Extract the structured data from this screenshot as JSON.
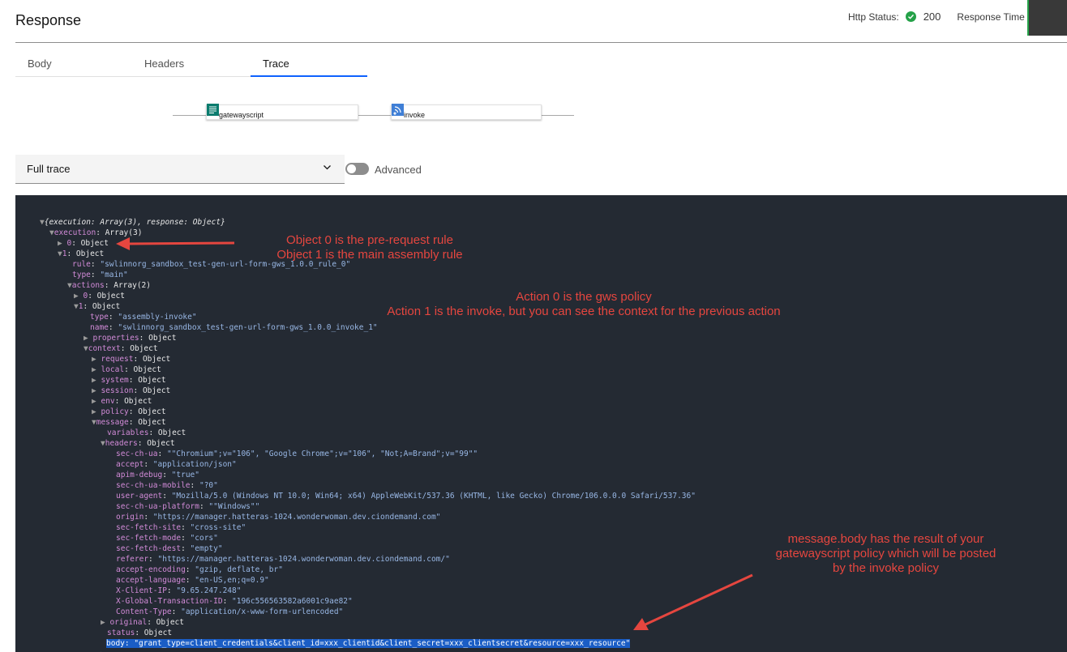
{
  "header": {
    "title": "Response",
    "http_status_label": "Http Status:",
    "http_status_code": "200",
    "response_time_label": "Response Time"
  },
  "tabs": [
    {
      "label": "Body"
    },
    {
      "label": "Headers"
    },
    {
      "label": "Trace"
    }
  ],
  "flow": {
    "node1": "gatewayscript",
    "node2": "invoke"
  },
  "controls": {
    "trace_select": "Full trace",
    "advanced_label": "Advanced"
  },
  "trace": {
    "l1": "{execution: Array(3), response: Object}",
    "l2k": "execution",
    "l2v": ": Array(3)",
    "l3k": "0",
    "l3v": ": Object",
    "l4k": "1",
    "l4v": ": Object",
    "l5k": "rule",
    "l5v": "\"swlinnorg_sandbox_test-gen-url-form-gws_1.0.0_rule_0\"",
    "l6k": "type",
    "l6v": "\"main\"",
    "l7k": "actions",
    "l7v": ": Array(2)",
    "l8k": "0",
    "l8v": ": Object",
    "l9k": "1",
    "l9v": ": Object",
    "l10k": "type",
    "l10v": "\"assembly-invoke\"",
    "l11k": "name",
    "l11v": "\"swlinnorg_sandbox_test-gen-url-form-gws_1.0.0_invoke_1\"",
    "l12k": "properties",
    "l12v": ": Object",
    "l13k": "context",
    "l13v": ": Object",
    "l14k": "request",
    "l14v": ": Object",
    "l15k": "local",
    "l15v": ": Object",
    "l16k": "system",
    "l16v": ": Object",
    "l17k": "session",
    "l17v": ": Object",
    "l18k": "env",
    "l18v": ": Object",
    "l19k": "policy",
    "l19v": ": Object",
    "l20k": "message",
    "l20v": ": Object",
    "l21k": "variables",
    "l21v": ": Object",
    "l22k": "headers",
    "l22v": ": Object",
    "h1k": "sec-ch-ua",
    "h1v": "\"\"Chromium\";v=\"106\", \"Google Chrome\";v=\"106\", \"Not;A=Brand\";v=\"99\"\"",
    "h2k": "accept",
    "h2v": "\"application/json\"",
    "h3k": "apim-debug",
    "h3v": "\"true\"",
    "h4k": "sec-ch-ua-mobile",
    "h4v": "\"?0\"",
    "h5k": "user-agent",
    "h5v": "\"Mozilla/5.0 (Windows NT 10.0; Win64; x64) AppleWebKit/537.36 (KHTML, like Gecko) Chrome/106.0.0.0 Safari/537.36\"",
    "h6k": "sec-ch-ua-platform",
    "h6v": "\"\"Windows\"\"",
    "h7k": "origin",
    "h7v": "\"https://manager.hatteras-1024.wonderwoman.dev.ciondemand.com\"",
    "h8k": "sec-fetch-site",
    "h8v": "\"cross-site\"",
    "h9k": "sec-fetch-mode",
    "h9v": "\"cors\"",
    "h10k": "sec-fetch-dest",
    "h10v": "\"empty\"",
    "h11k": "referer",
    "h11v": "\"https://manager.hatteras-1024.wonderwoman.dev.ciondemand.com/\"",
    "h12k": "accept-encoding",
    "h12v": "\"gzip, deflate, br\"",
    "h13k": "accept-language",
    "h13v": "\"en-US,en;q=0.9\"",
    "h14k": "X-Client-IP",
    "h14v": "\"9.65.247.248\"",
    "h15k": "X-Global-Transaction-ID",
    "h15v": "\"196c556563582a6001c9ae82\"",
    "h16k": "Content-Type",
    "h16v": "\"application/x-www-form-urlencoded\"",
    "l23k": "original",
    "l23v": ": Object",
    "l24k": "status",
    "l24v": ": Object",
    "l25": "body: \"grant_type=client_credentials&client_id=xxx_clientid&client_secret=xxx_clientsecret&resource=xxx_resource\""
  },
  "annotations": {
    "a1l1": "Object 0 is the pre-request rule",
    "a1l2": "Object 1 is the main assembly rule",
    "a2l1": "Action 0 is the gws policy",
    "a2l2": "Action 1 is the invoke, but you can see the context for the previous action",
    "a3l1": "message.body has the result of your",
    "a3l2": "gatewayscript policy which will be posted",
    "a3l3": "by the invoke policy",
    "arrow_color": "#e5463f"
  }
}
